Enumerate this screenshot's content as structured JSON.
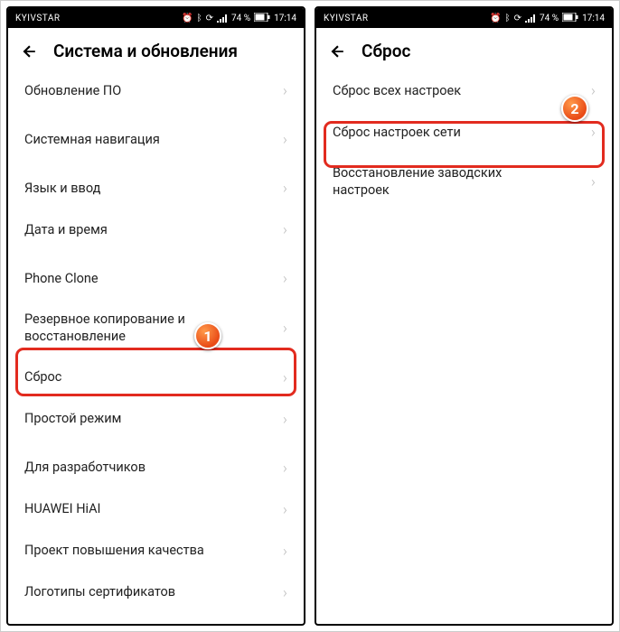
{
  "status": {
    "carrier": "KYIVSTAR",
    "battery": "74 %",
    "time": "17:14"
  },
  "left": {
    "title": "Система и обновления",
    "items": [
      {
        "label": "Обновление ПО"
      },
      {
        "label": "Системная навигация"
      },
      {
        "label": "Язык и ввод"
      },
      {
        "label": "Дата и время"
      },
      {
        "label": "Phone Clone"
      },
      {
        "label": "Резервное копирование и восстановление"
      },
      {
        "label": "Сброс"
      },
      {
        "label": "Простой режим"
      },
      {
        "label": "Для разработчиков"
      },
      {
        "label": "HUAWEI HiAI"
      },
      {
        "label": "Проект повышения качества"
      },
      {
        "label": "Логотипы сертификатов"
      }
    ]
  },
  "right": {
    "title": "Сброс",
    "items": [
      {
        "label": "Сброс всех настроек"
      },
      {
        "label": "Сброс настроек сети"
      },
      {
        "label": "Восстановление заводских настроек"
      }
    ]
  },
  "badges": {
    "one": "1",
    "two": "2"
  }
}
